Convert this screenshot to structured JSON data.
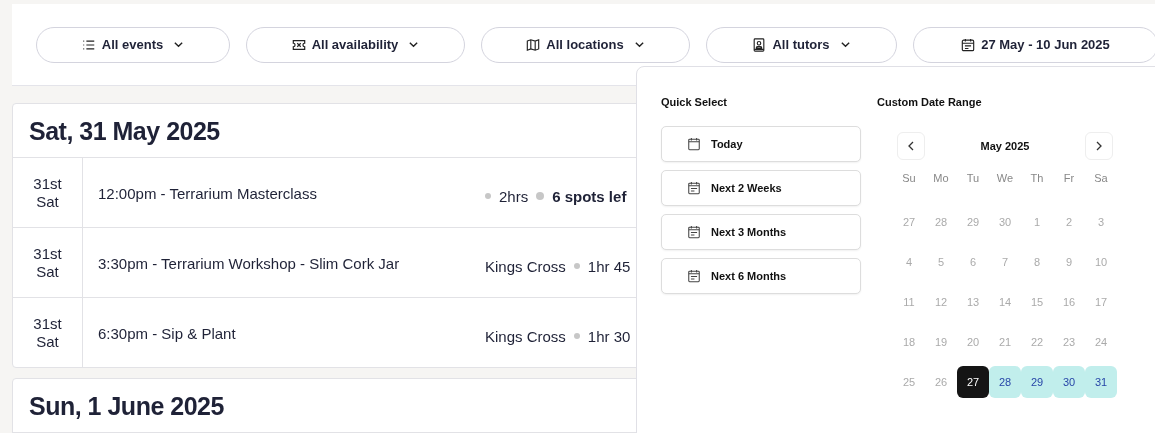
{
  "filters": [
    {
      "kind": "list",
      "label": "All events"
    },
    {
      "kind": "ticket",
      "label": "All availability"
    },
    {
      "kind": "map",
      "label": "All locations"
    },
    {
      "kind": "tutor",
      "label": "All tutors"
    },
    {
      "kind": "calendar",
      "label": "27 May - 10 Jun 2025"
    }
  ],
  "days": [
    {
      "heading": "Sat, 31 May 2025",
      "events": [
        {
          "day": "31st",
          "weekday": "Sat",
          "title": "12:00pm - Terrarium Masterclass",
          "duration": "2hrs",
          "spots": "6 spots lef"
        },
        {
          "day": "31st",
          "weekday": "Sat",
          "title": "3:30pm - Terrarium Workshop - Slim Cork Jar",
          "location": "Kings Cross",
          "duration": "1hr 45"
        },
        {
          "day": "31st",
          "weekday": "Sat",
          "title": "6:30pm - Sip & Plant",
          "location": "Kings Cross",
          "duration": "1hr 30"
        }
      ]
    },
    {
      "heading": "Sun, 1 June 2025"
    }
  ],
  "date_picker": {
    "quick_title": "Quick Select",
    "quick": [
      {
        "kind": "single",
        "label": "Today"
      },
      {
        "kind": "range",
        "label": "Next 2 Weeks"
      },
      {
        "kind": "range",
        "label": "Next 3 Months"
      },
      {
        "kind": "range",
        "label": "Next 6 Months"
      }
    ],
    "custom_title": "Custom Date Range",
    "month": "May 2025",
    "weekdays": [
      "Su",
      "Mo",
      "Tu",
      "We",
      "Th",
      "Fr",
      "Sa"
    ],
    "dates": [
      {
        "label": "27",
        "muted": true,
        "selected": false,
        "in_range": false
      },
      {
        "label": "28",
        "muted": true,
        "selected": false,
        "in_range": false
      },
      {
        "label": "29",
        "muted": true,
        "selected": false,
        "in_range": false
      },
      {
        "label": "30",
        "muted": true,
        "selected": false,
        "in_range": false
      },
      {
        "label": "1",
        "muted": true,
        "selected": false,
        "in_range": false
      },
      {
        "label": "2",
        "muted": true,
        "selected": false,
        "in_range": false
      },
      {
        "label": "3",
        "muted": true,
        "selected": false,
        "in_range": false
      },
      {
        "label": "4",
        "muted": true,
        "selected": false,
        "in_range": false
      },
      {
        "label": "5",
        "muted": true,
        "selected": false,
        "in_range": false
      },
      {
        "label": "6",
        "muted": true,
        "selected": false,
        "in_range": false
      },
      {
        "label": "7",
        "muted": true,
        "selected": false,
        "in_range": false
      },
      {
        "label": "8",
        "muted": true,
        "selected": false,
        "in_range": false
      },
      {
        "label": "9",
        "muted": true,
        "selected": false,
        "in_range": false
      },
      {
        "label": "10",
        "muted": true,
        "selected": false,
        "in_range": false
      },
      {
        "label": "11",
        "muted": true,
        "selected": false,
        "in_range": false
      },
      {
        "label": "12",
        "muted": true,
        "selected": false,
        "in_range": false
      },
      {
        "label": "13",
        "muted": true,
        "selected": false,
        "in_range": false
      },
      {
        "label": "14",
        "muted": true,
        "selected": false,
        "in_range": false
      },
      {
        "label": "15",
        "muted": true,
        "selected": false,
        "in_range": false
      },
      {
        "label": "16",
        "muted": true,
        "selected": false,
        "in_range": false
      },
      {
        "label": "17",
        "muted": true,
        "selected": false,
        "in_range": false
      },
      {
        "label": "18",
        "muted": true,
        "selected": false,
        "in_range": false
      },
      {
        "label": "19",
        "muted": true,
        "selected": false,
        "in_range": false
      },
      {
        "label": "20",
        "muted": true,
        "selected": false,
        "in_range": false
      },
      {
        "label": "21",
        "muted": true,
        "selected": false,
        "in_range": false
      },
      {
        "label": "22",
        "muted": true,
        "selected": false,
        "in_range": false
      },
      {
        "label": "23",
        "muted": true,
        "selected": false,
        "in_range": false
      },
      {
        "label": "24",
        "muted": true,
        "selected": false,
        "in_range": false
      },
      {
        "label": "25",
        "muted": true,
        "selected": false,
        "in_range": false
      },
      {
        "label": "26",
        "muted": true,
        "selected": false,
        "in_range": false
      },
      {
        "label": "27",
        "muted": false,
        "selected": true,
        "in_range": false
      },
      {
        "label": "28",
        "muted": false,
        "selected": false,
        "in_range": true
      },
      {
        "label": "29",
        "muted": false,
        "selected": false,
        "in_range": true
      },
      {
        "label": "30",
        "muted": false,
        "selected": false,
        "in_range": true
      },
      {
        "label": "31",
        "muted": false,
        "selected": false,
        "in_range": true
      }
    ]
  }
}
